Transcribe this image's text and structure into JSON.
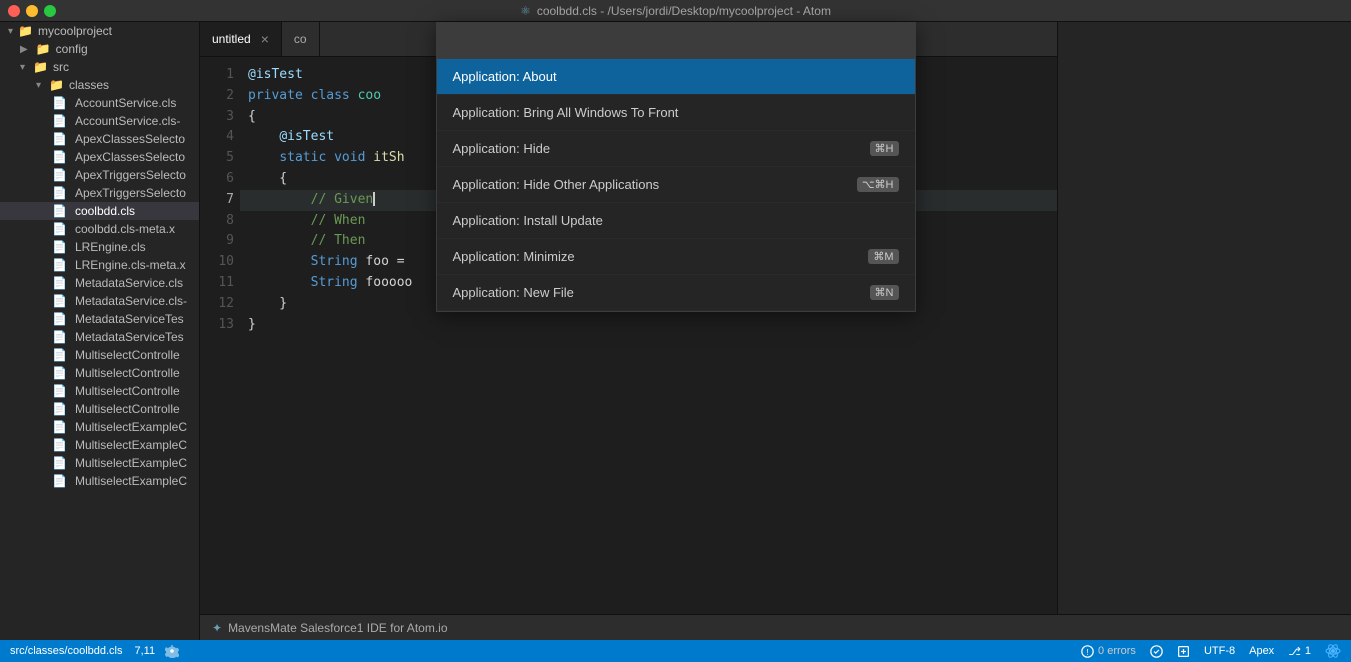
{
  "titlebar": {
    "title": "coolbdd.cls - /Users/jordi/Desktop/mycoolproject - Atom",
    "icon": "⚛"
  },
  "sidebar": {
    "project_name": "mycoolproject",
    "items": [
      {
        "label": "config",
        "type": "folder",
        "indent": 1
      },
      {
        "label": "src",
        "type": "folder",
        "indent": 1,
        "expanded": true
      },
      {
        "label": "classes",
        "type": "folder",
        "indent": 2,
        "expanded": true
      },
      {
        "label": "AccountService.cls",
        "type": "file",
        "indent": 3
      },
      {
        "label": "AccountService.cls-",
        "type": "file",
        "indent": 3
      },
      {
        "label": "ApexClassesSelecto",
        "type": "file",
        "indent": 3
      },
      {
        "label": "ApexClassesSelecto",
        "type": "file",
        "indent": 3
      },
      {
        "label": "ApexTriggersSelecto",
        "type": "file",
        "indent": 3
      },
      {
        "label": "ApexTriggersSelecto",
        "type": "file",
        "indent": 3
      },
      {
        "label": "coolbdd.cls",
        "type": "file",
        "indent": 3,
        "active": true
      },
      {
        "label": "coolbdd.cls-meta.x",
        "type": "file",
        "indent": 3
      },
      {
        "label": "LREngine.cls",
        "type": "file",
        "indent": 3
      },
      {
        "label": "LREngine.cls-meta.x",
        "type": "file",
        "indent": 3
      },
      {
        "label": "MetadataService.cls",
        "type": "file",
        "indent": 3
      },
      {
        "label": "MetadataService.cls-",
        "type": "file",
        "indent": 3
      },
      {
        "label": "MetadataServiceTes",
        "type": "file",
        "indent": 3
      },
      {
        "label": "MetadataServiceTes",
        "type": "file",
        "indent": 3
      },
      {
        "label": "MultiselectControlle",
        "type": "file",
        "indent": 3
      },
      {
        "label": "MultiselectControlle",
        "type": "file",
        "indent": 3
      },
      {
        "label": "MultiselectControlle",
        "type": "file",
        "indent": 3
      },
      {
        "label": "MultiselectControlle",
        "type": "file",
        "indent": 3
      },
      {
        "label": "MultiselectExampleC",
        "type": "file",
        "indent": 3
      },
      {
        "label": "MultiselectExampleC",
        "type": "file",
        "indent": 3
      },
      {
        "label": "MultiselectExampleC",
        "type": "file",
        "indent": 3
      },
      {
        "label": "MultiselectExampleC",
        "type": "file",
        "indent": 3
      }
    ]
  },
  "tabs": [
    {
      "label": "untitled",
      "active": true,
      "closable": true
    },
    {
      "label": "co",
      "active": false,
      "closable": false
    }
  ],
  "editor": {
    "lines": [
      {
        "num": 1,
        "content": "@isTest"
      },
      {
        "num": 2,
        "content": "private class coo"
      },
      {
        "num": 3,
        "content": "{"
      },
      {
        "num": 4,
        "content": "    @isTest"
      },
      {
        "num": 5,
        "content": "    static void itSh"
      },
      {
        "num": 6,
        "content": "    {"
      },
      {
        "num": 7,
        "content": "        // Given",
        "active": true
      },
      {
        "num": 8,
        "content": "        // When"
      },
      {
        "num": 9,
        "content": "        // Then"
      },
      {
        "num": 10,
        "content": "        String foo ="
      },
      {
        "num": 11,
        "content": "        String fooooo"
      },
      {
        "num": 12,
        "content": "    }"
      },
      {
        "num": 13,
        "content": "}"
      }
    ]
  },
  "command_palette": {
    "search_placeholder": "",
    "items": [
      {
        "label": "Application: About",
        "shortcut": [],
        "selected": true
      },
      {
        "label": "Application: Bring All Windows To Front",
        "shortcut": []
      },
      {
        "label": "Application: Hide",
        "shortcut": [
          "⌘H"
        ]
      },
      {
        "label": "Application: Hide Other Applications",
        "shortcut": [
          "⌥⌘H"
        ]
      },
      {
        "label": "Application: Install Update",
        "shortcut": []
      },
      {
        "label": "Application: Minimize",
        "shortcut": [
          "⌘M"
        ]
      },
      {
        "label": "Application: New File",
        "shortcut": [
          "⌘N"
        ]
      }
    ]
  },
  "mavens_bar": {
    "label": "MavensMate Salesforce1 IDE for Atom.io"
  },
  "statusbar": {
    "left": {
      "path": "src/classes/coolbdd.cls",
      "cursor": "7,11"
    },
    "right": {
      "errors": "0 errors",
      "encoding": "UTF-8",
      "language": "Apex",
      "git": "⎇ 1"
    }
  }
}
